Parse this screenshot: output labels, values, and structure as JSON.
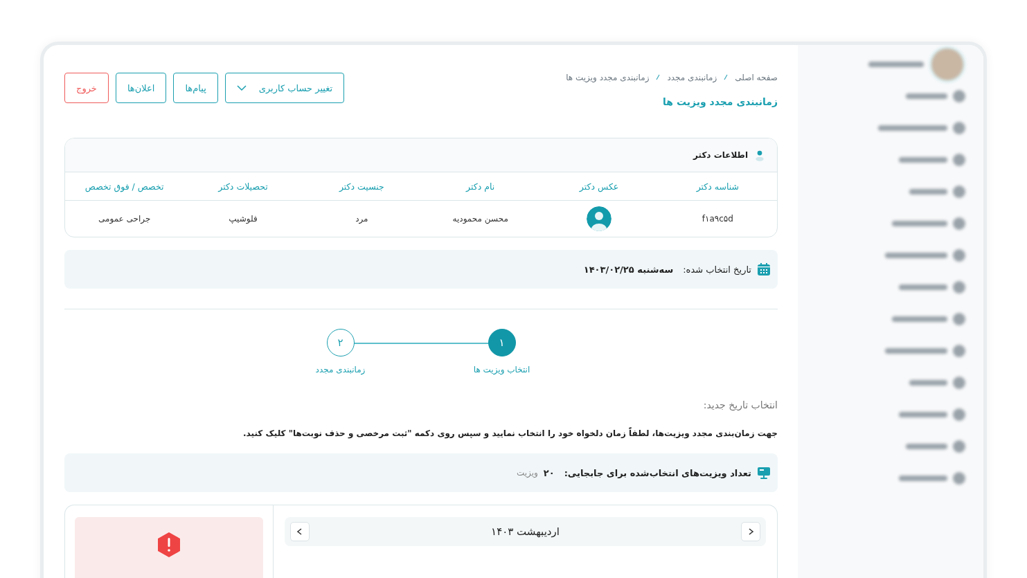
{
  "breadcrumb": [
    {
      "label": "صفحه اصلی"
    },
    {
      "label": "زمانبندی مجدد"
    },
    {
      "label": "زمانبندی مجدد ویزیت ها"
    }
  ],
  "page_title": "زمانبندی مجدد ویزیت ها",
  "header_buttons": [
    {
      "kind": "dropdown",
      "label": "تغییر حساب کاربری"
    },
    {
      "kind": "normal",
      "label": "پیام‌ها"
    },
    {
      "kind": "normal",
      "label": "اعلان‌ها"
    },
    {
      "kind": "danger",
      "label": "خروج"
    }
  ],
  "doctor_card": {
    "title": "اطلاعات دکتر",
    "columns": [
      "شناسه دکتر",
      "عکس دکتر",
      "نام دکتر",
      "جنسیت دکتر",
      "تحصیلات دکتر",
      "تخصص / فوق تخصص"
    ],
    "rows": [
      {
        "cells": [
          {
            "kind": "text",
            "text": "f۱a۹c۵d"
          },
          {
            "kind": "avatar"
          },
          {
            "kind": "text",
            "text": "محسن محمودیه"
          },
          {
            "kind": "text",
            "text": "مرد"
          },
          {
            "kind": "text",
            "text": "فلوشیپ"
          },
          {
            "kind": "text",
            "text": "جراحی عمومی"
          }
        ]
      }
    ]
  },
  "selected_date": {
    "label": "تاریخ انتخاب شده:",
    "value": "سه‌شنبه ۱۴۰۳/۰۲/۲۵"
  },
  "steps": [
    {
      "number": "۱",
      "label": "انتخاب ویزیت ها",
      "selected": true
    },
    {
      "number": "۲",
      "label": "زمانبندی مجدد",
      "selected": false
    }
  ],
  "section_label": "انتخاب تاریخ جدید:",
  "instruction": "جهت زمان‌بندی مجدد ویزیت‌ها، لطفاً زمان دلخواه خود را انتخاب نمایید و سپس روی دکمه \"ثبت مرخصی و حذف نوبت‌ها\" کلیک کنید.",
  "visit_count": {
    "label": "تعداد ویزیت‌های انتخاب‌شده برای جابجایی:",
    "value": "۲۰",
    "unit": "ویزیت"
  },
  "calendar": {
    "month": "اردیبهشت ۱۴۰۳"
  }
}
